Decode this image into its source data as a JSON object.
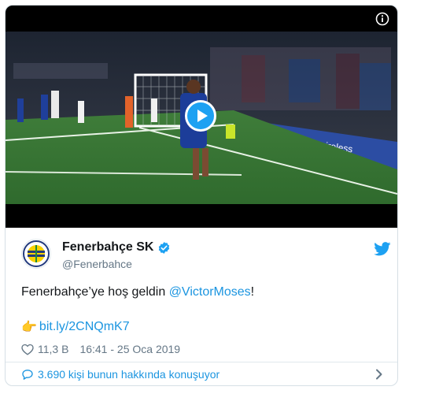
{
  "account": {
    "name": "Fenerbahçe SK",
    "handle": "@Fenerbahce"
  },
  "tweet": {
    "text_before": "Fenerbahçe’ye hoş geldin ",
    "mention": "@VictorMoses",
    "text_after": "!",
    "link_emoji": "👉",
    "link": "bit.ly/2CNQmK7",
    "likes": "11,3 B",
    "timestamp": "16:41 - 25 Oca 2019"
  },
  "footer": {
    "conversation": "3.690 kişi bunun hakkında konuşuyor"
  },
  "icons": {
    "info": "info-icon",
    "play": "play-icon",
    "verified": "verified-badge-icon",
    "twitter": "twitter-bird-icon",
    "like": "heart-icon",
    "reply": "speech-bubble-icon",
    "chevron": "chevron-right-icon"
  },
  "colors": {
    "accent": "#1da1f2",
    "link": "#1b95e0",
    "text": "#14171a",
    "muted": "#657786",
    "border": "#e1e8ed"
  }
}
